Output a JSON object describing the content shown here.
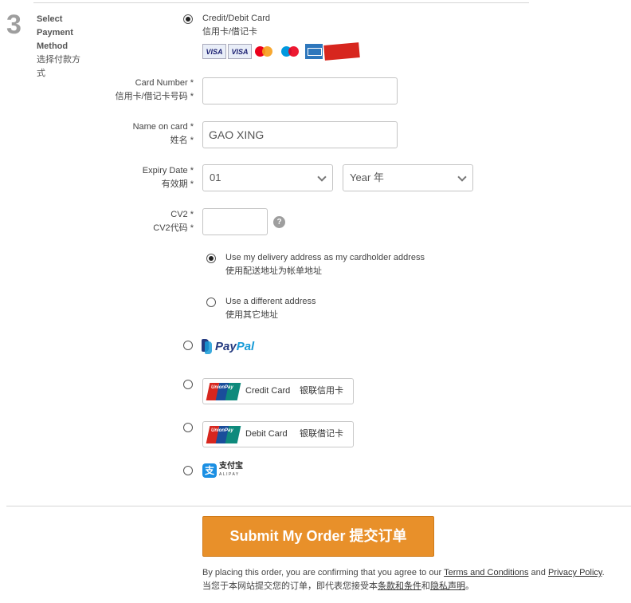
{
  "step": {
    "number": "3",
    "title_en_lines": [
      "Select",
      "Payment",
      "Method"
    ],
    "title_cn_lines": [
      "选择付款方",
      "式"
    ]
  },
  "payment": {
    "card_option": {
      "label_en": "Credit/Debit Card",
      "label_cn": "信用卡/借记卡",
      "selected": true
    },
    "card_logos": [
      "VISA",
      "VISA",
      "mastercard",
      "maestro",
      "amex",
      "UnionPay"
    ],
    "fields": {
      "card_number": {
        "label_en": "Card Number *",
        "label_cn": "信用卡/借记卡号码 *",
        "value": ""
      },
      "name_on_card": {
        "label_en": "Name on card *",
        "label_cn": "姓名 *",
        "value": "GAO XING"
      },
      "expiry": {
        "label_en": "Expiry Date *",
        "label_cn": "有效期 *",
        "month_value": "01",
        "year_value": "Year 年"
      },
      "cv2": {
        "label_en": "CV2 *",
        "label_cn": "CV2代码 *",
        "value": "",
        "help_icon": "?"
      }
    },
    "address_options": [
      {
        "label_en": "Use my delivery address as my cardholder address",
        "label_cn": "使用配送地址为帐单地址",
        "selected": true
      },
      {
        "label_en": "Use a different address",
        "label_cn": "使用其它地址",
        "selected": false
      }
    ],
    "paypal": {
      "text_dark": "Pay",
      "text_light": "Pal",
      "selected": false
    },
    "unionpay_credit": {
      "logo_text": "UnionPay",
      "label_en": "Credit Card",
      "label_cn": "银联信用卡",
      "selected": false
    },
    "unionpay_debit": {
      "logo_text": "UnionPay",
      "label_en": "Debit Card",
      "label_cn": "银联借记卡",
      "selected": false
    },
    "alipay": {
      "icon_glyph": "支",
      "text_cn": "支付宝",
      "text_en": "ALIPAY",
      "selected": false
    }
  },
  "submit": {
    "label": "Submit My Order 提交订单"
  },
  "terms": {
    "line1_prefix": "By placing this order, you are confirming that you agree to our ",
    "terms_link": "Terms and Conditions",
    "line1_and": " and ",
    "privacy_link": "Privacy Policy",
    "line1_end": ".",
    "line2_prefix": "当您于本网站提交您的订单，即代表您接受本",
    "terms_link_cn": "条款和条件",
    "line2_and": "和",
    "privacy_link_cn": "隐私声明",
    "line2_end": "。"
  },
  "colors": {
    "accent_orange": "#e8902a",
    "paypal_dark": "#253b80",
    "paypal_light": "#179bd7",
    "unionpay_red": "#d7261e",
    "alipay_blue": "#1a8fe3"
  }
}
